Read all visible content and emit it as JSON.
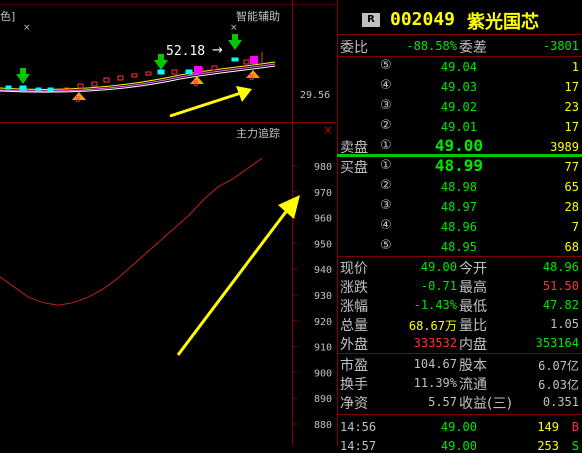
{
  "top_panel": {
    "title": "智能辅助",
    "left_cut_label": "色]",
    "price_label": "52.18",
    "price_arrow": "→",
    "axis_value": "29.56",
    "markers": [
      "B",
      "B",
      "B"
    ]
  },
  "bottom_panel": {
    "title": "主力追踪",
    "close_icon": "×",
    "y_ticks": [
      "980",
      "970",
      "960",
      "950",
      "940",
      "930",
      "920",
      "910",
      "900",
      "890",
      "880"
    ],
    "chart_data": {
      "type": "line",
      "title": "主力追踪",
      "ylim": [
        880,
        985
      ],
      "y_ticks": [
        980,
        970,
        960,
        950,
        940,
        930,
        920,
        910,
        900,
        890,
        880
      ],
      "series": [
        {
          "values": [
            937,
            933,
            929,
            927,
            926,
            927,
            929,
            932,
            936,
            941,
            946,
            951,
            956,
            961,
            967,
            972,
            975,
            979,
            983
          ]
        }
      ],
      "color": "#c81e1e"
    }
  },
  "quote": {
    "badge": "R",
    "code": "002049",
    "name": "紫光国芯",
    "weibi_label": "委比",
    "weibi_value": "-88.58%",
    "weicha_label": "委差",
    "weicha_value": "-3801",
    "sell_levels": [
      {
        "idx": "⑤",
        "price": "49.04",
        "vol": "1"
      },
      {
        "idx": "④",
        "price": "49.03",
        "vol": "17"
      },
      {
        "idx": "③",
        "price": "49.02",
        "vol": "23"
      },
      {
        "idx": "②",
        "price": "49.01",
        "vol": "17"
      },
      {
        "idx": "①",
        "price": "49.00",
        "vol": "3989"
      }
    ],
    "sell_label": "卖盘",
    "buy_label": "买盘",
    "buy_levels": [
      {
        "idx": "①",
        "price": "48.99",
        "vol": "77"
      },
      {
        "idx": "②",
        "price": "48.98",
        "vol": "65"
      },
      {
        "idx": "③",
        "price": "48.97",
        "vol": "28"
      },
      {
        "idx": "④",
        "price": "48.96",
        "vol": "7"
      },
      {
        "idx": "⑤",
        "price": "48.95",
        "vol": "68"
      }
    ],
    "stats": [
      {
        "l1": "现价",
        "v1": "49.00",
        "c1": "green",
        "l2": "今开",
        "v2": "48.96",
        "c2": "green"
      },
      {
        "l1": "涨跌",
        "v1": "-0.71",
        "c1": "green",
        "l2": "最高",
        "v2": "51.50",
        "c2": "red"
      },
      {
        "l1": "涨幅",
        "v1": "-1.43%",
        "c1": "green",
        "l2": "最低",
        "v2": "47.82",
        "c2": "green"
      },
      {
        "l1": "总量",
        "v1": "68.67万",
        "c1": "yellow",
        "l2": "量比",
        "v2": "1.05",
        "c2": "white"
      },
      {
        "l1": "外盘",
        "v1": "333532",
        "c1": "red",
        "l2": "内盘",
        "v2": "353164",
        "c2": "green"
      }
    ],
    "fund": [
      {
        "l1": "市盈",
        "v1": "104.67",
        "l2": "股本",
        "v2": "6.07亿"
      },
      {
        "l1": "换手",
        "v1": "11.39%",
        "l2": "流通",
        "v2": "6.03亿"
      },
      {
        "l1": "净资",
        "v1": "5.57",
        "l2": "收益(三)",
        "v2": "0.351"
      }
    ],
    "ticks": [
      {
        "time": "14:56",
        "price": "49.00",
        "vol": "149",
        "side": "B"
      },
      {
        "time": "14:57",
        "price": "49.00",
        "vol": "253",
        "side": "S"
      }
    ]
  }
}
